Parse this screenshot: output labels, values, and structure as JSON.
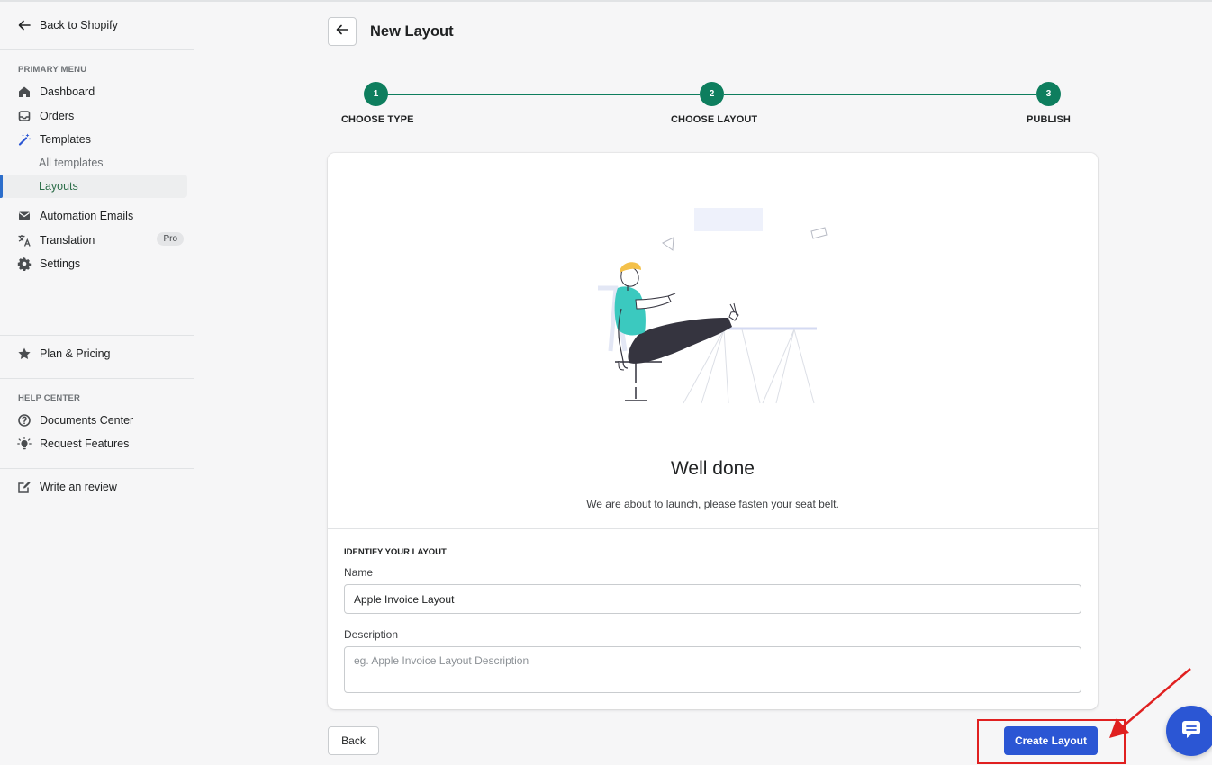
{
  "sidebar": {
    "back_label": "Back to Shopify",
    "primary_heading": "PRIMARY MENU",
    "items": [
      {
        "label": "Dashboard",
        "icon": "home-icon"
      },
      {
        "label": "Orders",
        "icon": "inbox-icon"
      },
      {
        "label": "Templates",
        "icon": "magic-wand-icon"
      },
      {
        "label": "All templates"
      },
      {
        "label": "Layouts",
        "active": true
      },
      {
        "label": "Automation Emails",
        "icon": "envelope-icon"
      },
      {
        "label": "Translation",
        "icon": "translate-icon",
        "badge": "Pro"
      },
      {
        "label": "Settings",
        "icon": "gear-icon"
      }
    ],
    "plan_label": "Plan & Pricing",
    "help_heading": "HELP CENTER",
    "help_items": [
      {
        "label": "Documents Center",
        "icon": "question-circle-icon"
      },
      {
        "label": "Request Features",
        "icon": "lightbulb-icon"
      }
    ],
    "review_label": "Write an review"
  },
  "header": {
    "title": "New Layout"
  },
  "stepper": {
    "steps": [
      {
        "number": "1",
        "label": "CHOOSE TYPE"
      },
      {
        "number": "2",
        "label": "CHOOSE LAYOUT"
      },
      {
        "number": "3",
        "label": "PUBLISH"
      }
    ]
  },
  "card": {
    "heading": "Well done",
    "subtext": "We are about to launch, please fasten your seat belt.",
    "section_title": "IDENTIFY YOUR LAYOUT",
    "name_label": "Name",
    "name_value": "Apple Invoice Layout",
    "description_label": "Description",
    "description_placeholder": "eg. Apple Invoice Layout Description"
  },
  "footer": {
    "back_label": "Back",
    "create_label": "Create Layout"
  },
  "colors": {
    "accent": "#2b56d4",
    "step_green": "#0e7e5e",
    "annotation_red": "#e02020"
  }
}
